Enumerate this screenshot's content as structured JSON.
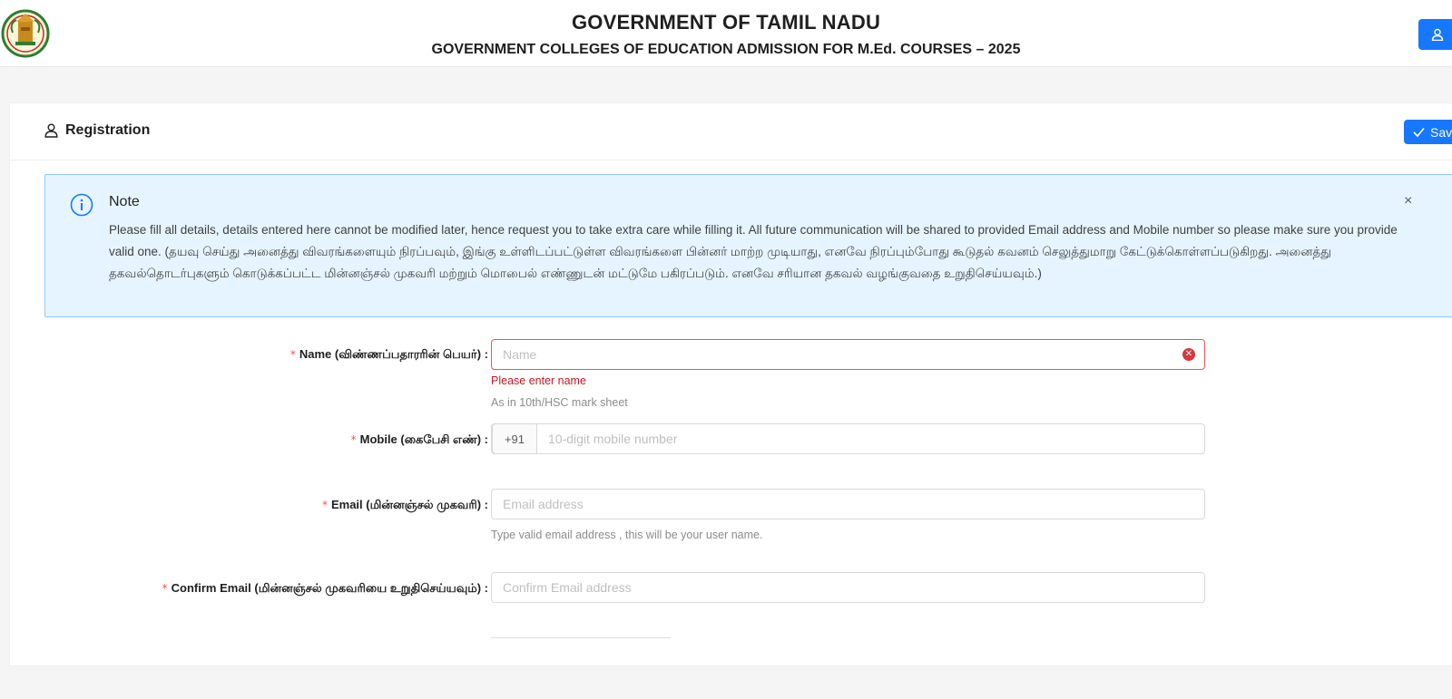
{
  "header": {
    "title": "GOVERNMENT OF TAMIL NADU",
    "subtitle": "GOVERNMENT COLLEGES OF EDUCATION ADMISSION FOR M.Ed. COURSES – 2025"
  },
  "card": {
    "title": "Registration",
    "save_label": "Sav"
  },
  "note": {
    "title": "Note",
    "description": "Please fill all details, details entered here cannot be modified later, hence request you to take extra care while filling it. All future communication will be shared to provided Email address and Mobile number so please make sure you provide valid one. (தயவு செய்து அனைத்து விவரங்களையும் நிரப்பவும், இங்கு உள்ளிடப்பட்டுள்ள விவரங்களை பின்னர் மாற்ற முடியாது, எனவே நிரப்பும்போது கூடுதல் கவனம் செலுத்துமாறு கேட்டுக்கொள்ளப்படுகிறது. அனைத்து தகவல்தொடர்புகளும் கொடுக்கப்பட்ட மின்னஞ்சல் முகவரி மற்றும் மொபைல் எண்ணுடன் மட்டுமே பகிரப்படும். எனவே சரியான தகவல் வழங்குவதை உறுதிசெய்யவும்.)",
    "close": "×"
  },
  "form": {
    "required_mark": "*",
    "name": {
      "label": "Name (விண்ணப்பதாரரின் பெயர்) :",
      "placeholder": "Name",
      "error": "Please enter name",
      "help": "As in 10th/HSC mark sheet"
    },
    "mobile": {
      "label": "Mobile (கைபேசி எண்) :",
      "prefix": "+91",
      "placeholder": "10-digit mobile number"
    },
    "email": {
      "label": "Email (மின்னஞ்சல் முகவரி) :",
      "placeholder": "Email address",
      "help": "Type valid email address , this will be your user name."
    },
    "confirm_email": {
      "label": "Confirm Email (மின்னஞ்சல் முகவரியை உறுதிசெய்யவும்) :",
      "placeholder": "Confirm Email address"
    }
  },
  "colors": {
    "primary": "#1677ff",
    "error": "#ff4d4f",
    "alert_bg": "#e6f4ff",
    "alert_border": "#91caff"
  },
  "icons": {
    "logo": "tamil-nadu-emblem",
    "user": "user-icon",
    "info": "info-circle-icon",
    "check": "check-icon",
    "close": "close-icon"
  }
}
